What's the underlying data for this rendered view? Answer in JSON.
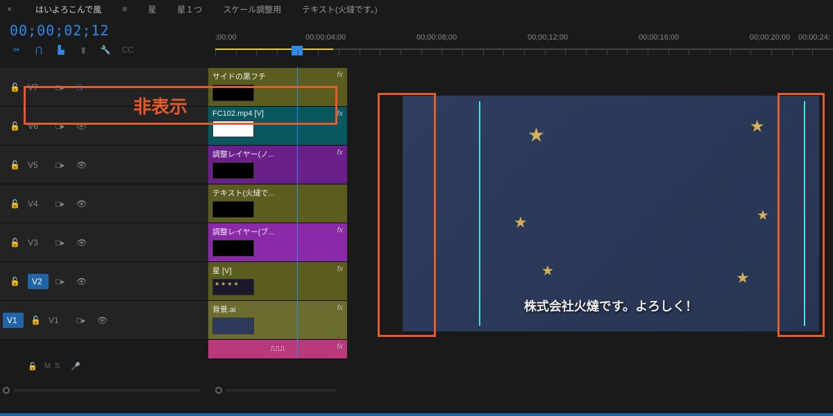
{
  "topBar": {
    "tabTitle": "はいよろこんで風",
    "breadcrumb1": "星",
    "breadcrumb2": "星１つ",
    "breadcrumb3": "スケール調整用",
    "breadcrumb4": "テキスト(火燵です。)"
  },
  "timecode": "00;00;02;12",
  "ruler": {
    "labels": [
      ";00;00",
      "00;00;04;00",
      "00;00;08;00",
      "00;00;12;00",
      "00;00;16;00",
      "00;00;20;00",
      "00;00;24;"
    ]
  },
  "tracks": [
    {
      "id": "V7",
      "hidden": true
    },
    {
      "id": "V6",
      "hidden": false
    },
    {
      "id": "V5",
      "hidden": false
    },
    {
      "id": "V4",
      "hidden": false
    },
    {
      "id": "V3",
      "hidden": false
    },
    {
      "id": "V2",
      "hidden": false,
      "active": true
    },
    {
      "id": "V1",
      "hidden": false,
      "activeLeft": true
    }
  ],
  "clips": [
    {
      "label": "サイドの黒フチ",
      "fx": "fx"
    },
    {
      "label": "FC102.mp4 [V]",
      "fx": "fx"
    },
    {
      "label": "調整レイヤー(ノ...",
      "fx": "fx"
    },
    {
      "label": "テキスト(火燵で...",
      "fx": ""
    },
    {
      "label": "調整レイヤー(ブ...",
      "fx": "fx"
    },
    {
      "label": "星 [V]",
      "fx": "fx"
    },
    {
      "label": "背景.ai",
      "fx": "fx"
    }
  ],
  "audioRow": {
    "m": "M",
    "s": "S"
  },
  "preview": {
    "caption": "株式会社火燵です。よろしく！"
  },
  "annotation": {
    "hiddenLabel": "非表示"
  },
  "icons": {
    "fx": "fx",
    "waveform": "⎍⎍⎍"
  }
}
